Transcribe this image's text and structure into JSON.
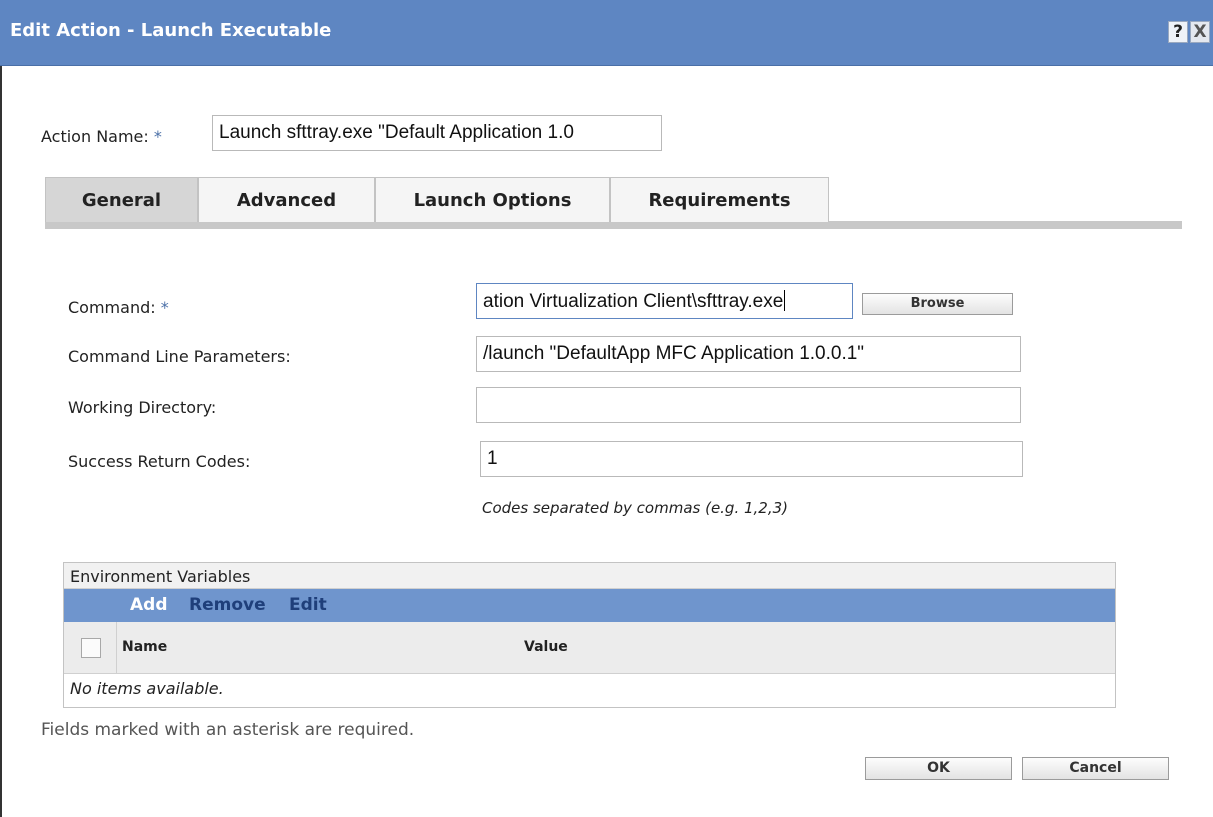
{
  "dialog": {
    "title": "Edit Action - Launch Executable",
    "help_glyph": "?",
    "close_glyph": "X"
  },
  "action_name": {
    "label": "Action Name:",
    "required_mark": "*",
    "value": "Launch sfttray.exe \"Default Application 1.0"
  },
  "tabs": [
    {
      "label": "General"
    },
    {
      "label": "Advanced"
    },
    {
      "label": "Launch Options"
    },
    {
      "label": "Requirements"
    }
  ],
  "general": {
    "command": {
      "label": "Command:",
      "required_mark": "*",
      "value": "ation Virtualization Client\\sfttray.exe",
      "browse_label": "Browse"
    },
    "command_line_parameters": {
      "label": "Command Line Parameters:",
      "value": "/launch \"DefaultApp MFC Application 1.0.0.1\""
    },
    "working_directory": {
      "label": "Working Directory:",
      "value": ""
    },
    "success_return_codes": {
      "label": "Success Return Codes:",
      "value": "1",
      "hint": "Codes separated by commas (e.g. 1,2,3)"
    }
  },
  "environment_variables": {
    "title": "Environment Variables",
    "actions": {
      "add": "Add",
      "remove": "Remove",
      "edit": "Edit"
    },
    "columns": {
      "name": "Name",
      "value": "Value"
    },
    "empty_message": "No items available."
  },
  "footnote": "Fields marked with an asterisk are required.",
  "buttons": {
    "ok": "OK",
    "cancel": "Cancel"
  },
  "colors": {
    "titlebar": "#5e86c2",
    "toolbar": "#6f95cd",
    "action_add": "#ffffff",
    "action_link": "#1f3f7a",
    "required": "#4a6fa7"
  }
}
